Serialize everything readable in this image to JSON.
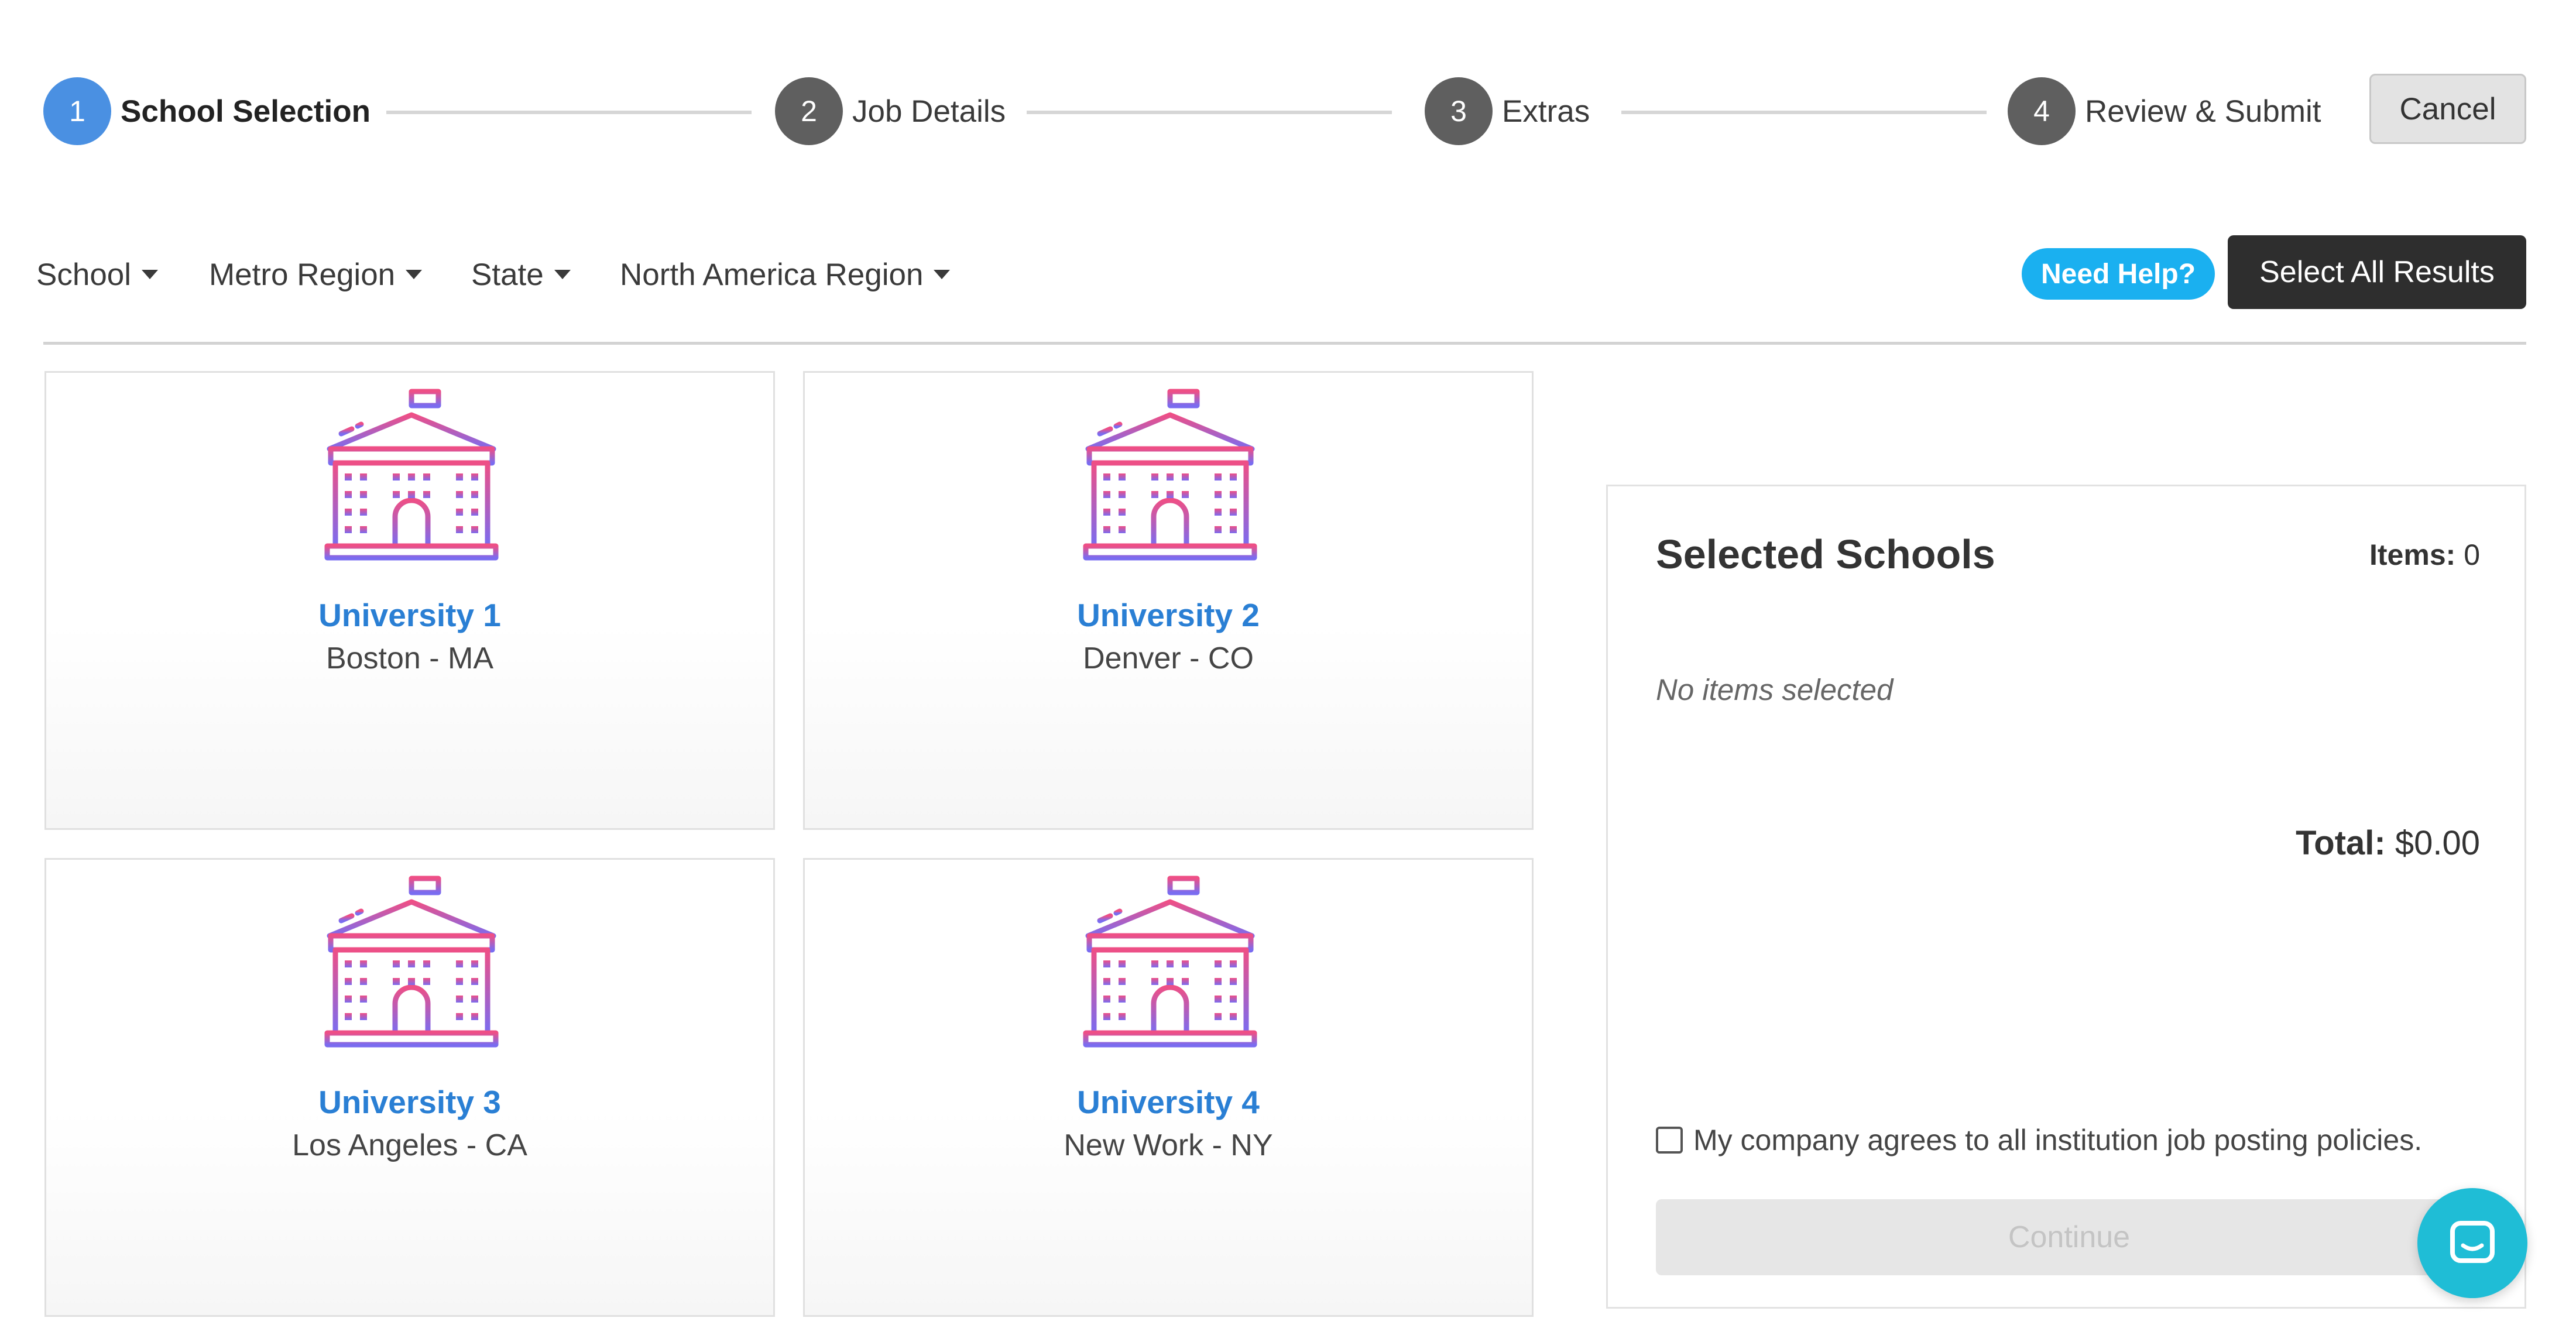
{
  "stepper": {
    "steps": [
      {
        "number": "1",
        "label": "School Selection"
      },
      {
        "number": "2",
        "label": "Job Details"
      },
      {
        "number": "3",
        "label": "Extras"
      },
      {
        "number": "4",
        "label": "Review & Submit"
      }
    ],
    "active_step": 1,
    "cancel_label": "Cancel"
  },
  "filters": {
    "items": [
      "School",
      "Metro Region",
      "State",
      "North America Region"
    ],
    "need_help_label": "Need Help?",
    "select_all_label": "Select All Results"
  },
  "schools": [
    {
      "name": "University 1",
      "location": "Boston - MA"
    },
    {
      "name": "University 2",
      "location": "Denver - CO"
    },
    {
      "name": "University 3",
      "location": "Los Angeles - CA"
    },
    {
      "name": "University 4",
      "location": "New Work - NY"
    }
  ],
  "selected_panel": {
    "title": "Selected Schools",
    "items_label": "Items:",
    "items_value": "0",
    "empty_text": "No items selected",
    "total_label": "Total:",
    "total_value": "$0.00",
    "agree_text": "My company agrees to all institution job posting policies.",
    "continue_label": "Continue"
  },
  "colors": {
    "active_step": "#4a90e2",
    "inactive_step": "#5f5f5f",
    "link_blue": "#2a7fd4",
    "help_blue": "#1ab0f0",
    "chat_teal": "#1fbdd6",
    "icon_gradient_top": "#ee4f86",
    "icon_gradient_bottom": "#7a6cf0"
  },
  "icons": {
    "school": "school-building-icon",
    "chat": "chat-icon",
    "caret": "caret-down-icon"
  }
}
